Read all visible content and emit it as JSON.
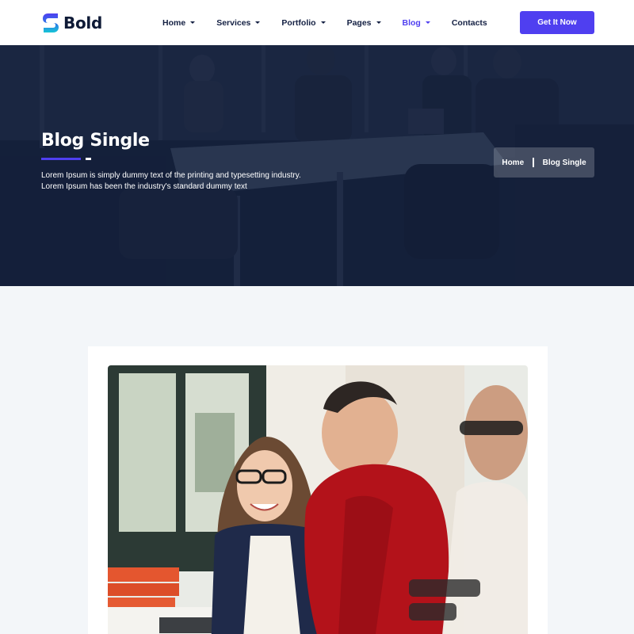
{
  "brand": {
    "name": "Bold",
    "logo_icon": "s-logo-icon",
    "accent": "#4f3ff0"
  },
  "nav": {
    "items": [
      {
        "label": "Home",
        "has_dropdown": true,
        "active": false
      },
      {
        "label": "Services",
        "has_dropdown": true,
        "active": false
      },
      {
        "label": "Portfolio",
        "has_dropdown": true,
        "active": false
      },
      {
        "label": "Pages",
        "has_dropdown": true,
        "active": false
      },
      {
        "label": "Blog",
        "has_dropdown": true,
        "active": true
      },
      {
        "label": "Contacts",
        "has_dropdown": false,
        "active": false
      }
    ],
    "cta_label": "Get It Now"
  },
  "hero": {
    "title": "Blog Single",
    "text_line1": "Lorem Ipsum is simply dummy text of the printing and typesetting industry.",
    "text_line2": "Lorem Ipsum has been the industry's standard dummy text",
    "breadcrumb": {
      "home": "Home",
      "current": "Blog Single"
    }
  },
  "post": {
    "image": "office-team-photo"
  }
}
